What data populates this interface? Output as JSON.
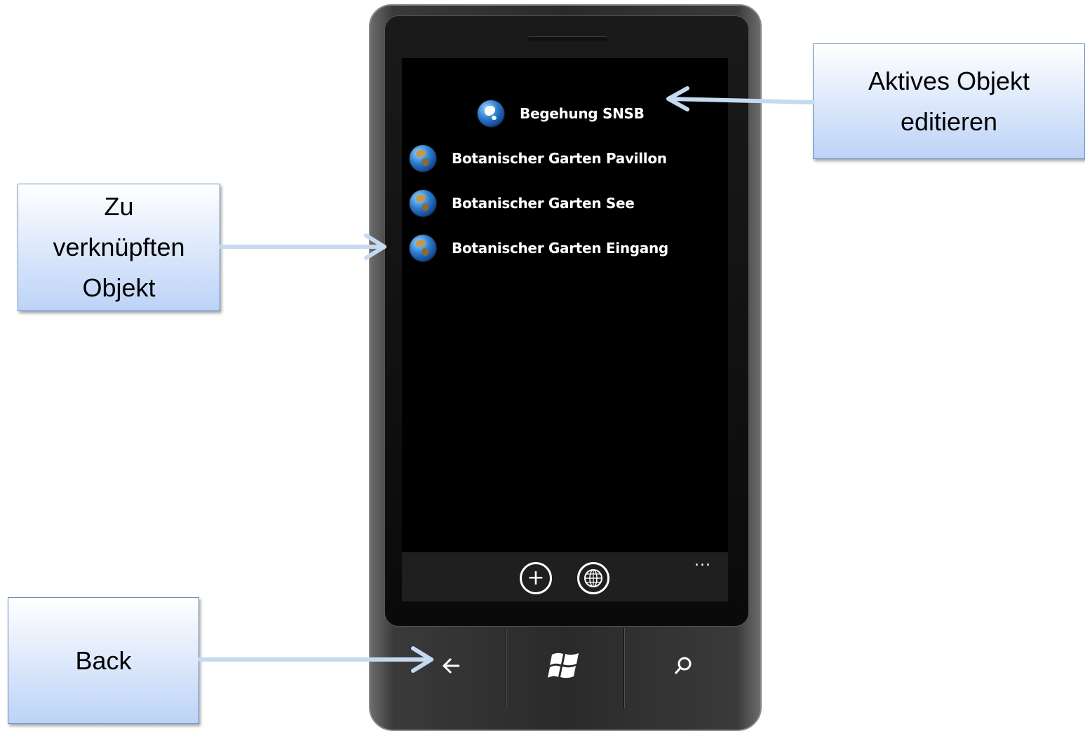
{
  "callouts": {
    "active_object": [
      "Aktives Objekt",
      "editieren"
    ],
    "linked_object": [
      "Zu",
      "verknüpften",
      "Objekt"
    ],
    "back": "Back"
  },
  "screen": {
    "active_item": {
      "label": "Begehung SNSB",
      "icon": "globe-icon"
    },
    "items": [
      {
        "label": "Botanischer Garten Pavillon",
        "icon": "globe-icon"
      },
      {
        "label": "Botanischer Garten See",
        "icon": "globe-icon"
      },
      {
        "label": "Botanischer Garten Eingang",
        "icon": "globe-icon"
      }
    ],
    "appbar": {
      "buttons": [
        {
          "icon": "add-icon",
          "glyph": "+"
        },
        {
          "icon": "globe-grid-icon"
        }
      ],
      "more": "..."
    }
  },
  "hardware_buttons": [
    {
      "icon": "back-arrow-icon"
    },
    {
      "icon": "windows-logo-icon"
    },
    {
      "icon": "search-icon"
    }
  ],
  "colors": {
    "callout_top": "#ffffff",
    "callout_bottom": "#bcd3f7",
    "arrow": "#c5d9f1",
    "screen_bg": "#000000",
    "appbar_bg": "#1f1f1f"
  }
}
